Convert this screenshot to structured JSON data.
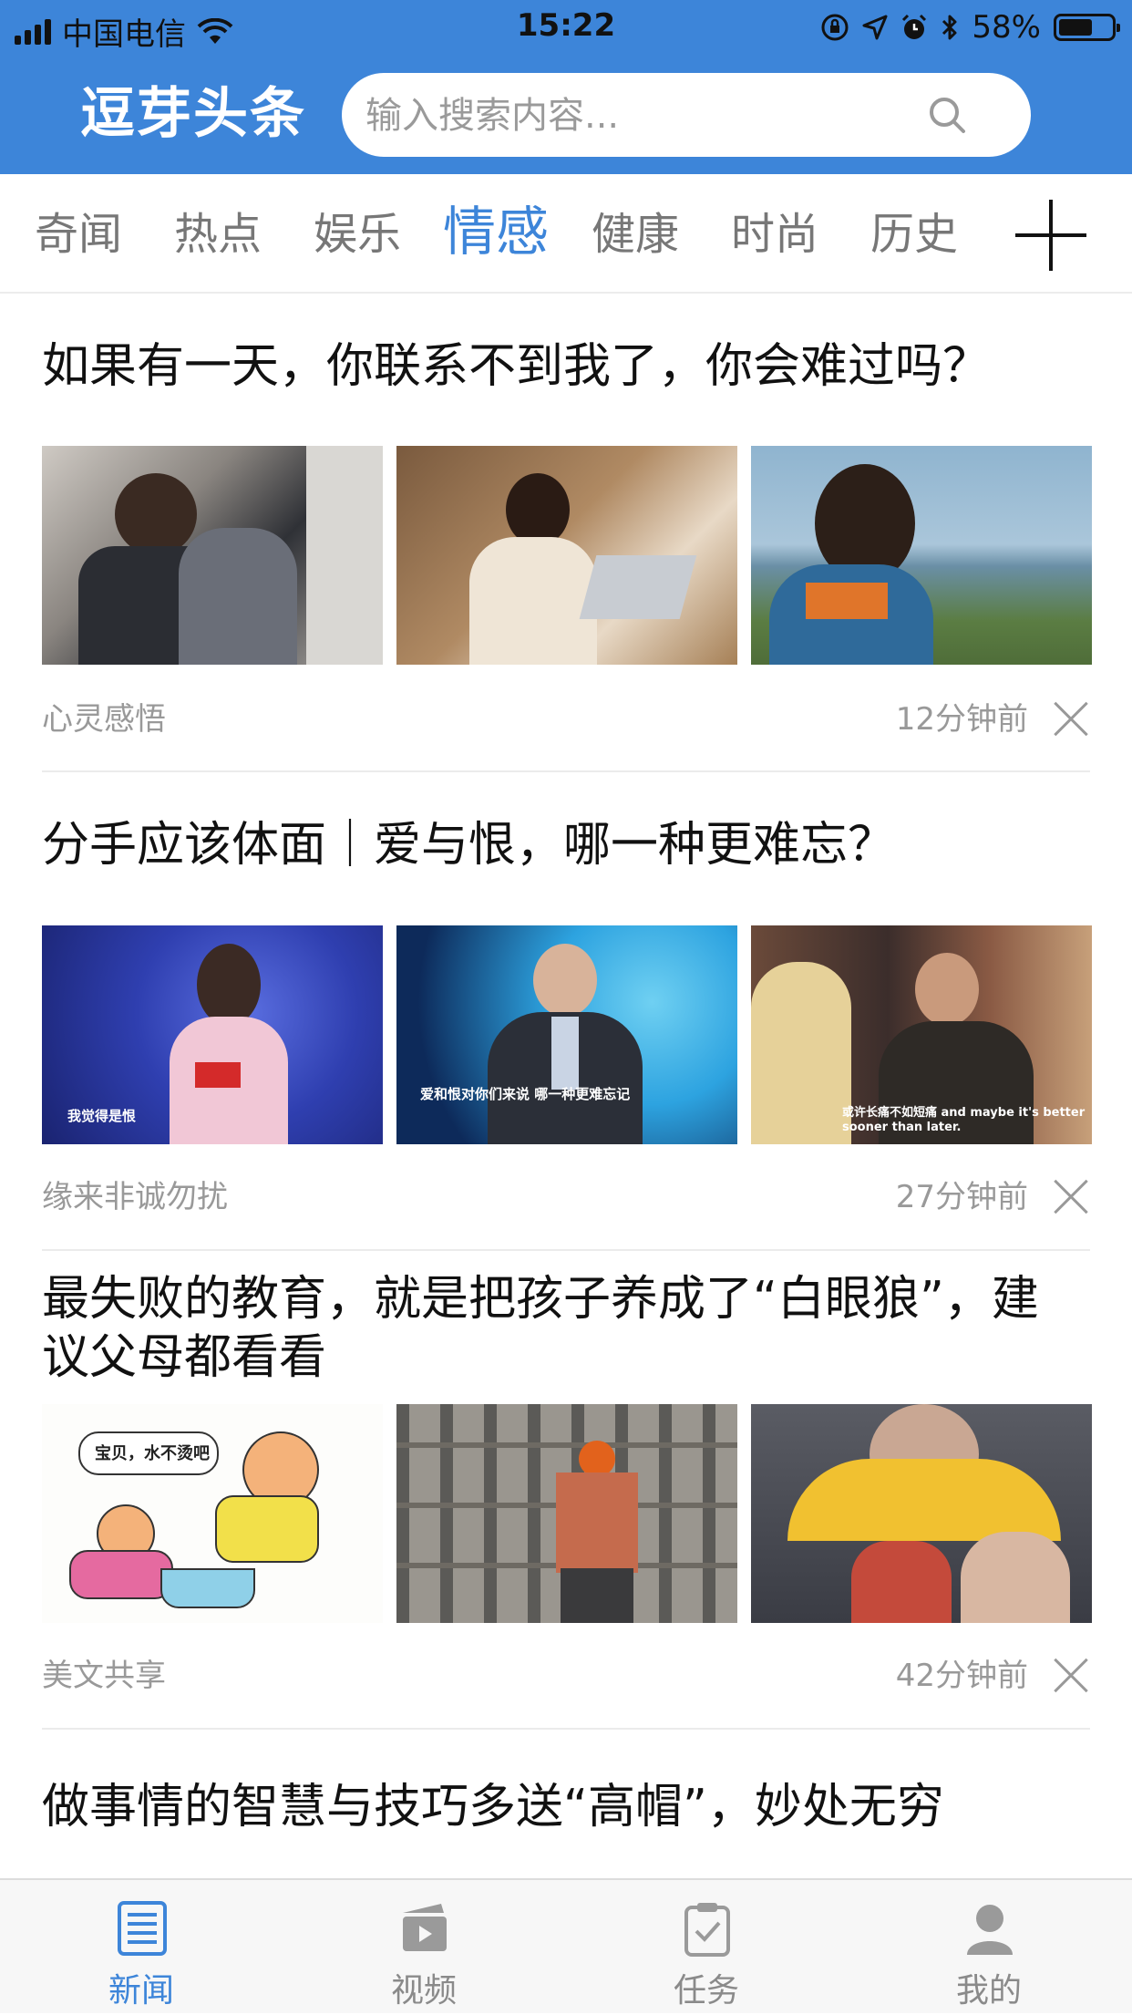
{
  "status_bar": {
    "carrier": "中国电信",
    "time": "15:22",
    "battery_percent": "58%"
  },
  "header": {
    "logo": "逗芽头条",
    "search_placeholder": "输入搜索内容..."
  },
  "tabs": [
    {
      "label": "奇闻",
      "active": false
    },
    {
      "label": "热点",
      "active": false
    },
    {
      "label": "娱乐",
      "active": false
    },
    {
      "label": "情感",
      "active": true
    },
    {
      "label": "健康",
      "active": false
    },
    {
      "label": "时尚",
      "active": false
    },
    {
      "label": "历史",
      "active": false
    }
  ],
  "articles": [
    {
      "title": "如果有一天，你联系不到我了，你会难过吗？",
      "source": "心灵感悟",
      "time": "12分钟前",
      "images": [
        {
          "caption": ""
        },
        {
          "caption": ""
        },
        {
          "caption": ""
        }
      ]
    },
    {
      "title": "分手应该体面｜爱与恨，哪一种更难忘？",
      "source": "缘来非诚勿扰",
      "time": "27分钟前",
      "images": [
        {
          "caption": "我觉得是恨"
        },
        {
          "caption": "爱和恨对你们来说 哪一种更难忘记"
        },
        {
          "caption": "或许长痛不如短痛 and maybe it's better sooner than later."
        }
      ]
    },
    {
      "title": "最失败的教育，就是把孩子养成了“白眼狼”，建议父母都看看",
      "source": "美文共享",
      "time": "42分钟前",
      "images": [
        {
          "caption": "宝贝，水不烫吧"
        },
        {
          "caption": ""
        },
        {
          "caption": ""
        }
      ]
    },
    {
      "title": "做事情的智慧与技巧多送“高帽”，妙处无穷"
    }
  ],
  "bottom_nav": [
    {
      "label": "新闻",
      "icon": "news-icon",
      "active": true
    },
    {
      "label": "视频",
      "icon": "video-icon",
      "active": false
    },
    {
      "label": "任务",
      "icon": "task-icon",
      "active": false
    },
    {
      "label": "我的",
      "icon": "profile-icon",
      "active": false
    }
  ],
  "colors": {
    "brand": "#3d85d9",
    "text": "#111111",
    "muted": "#999999"
  }
}
